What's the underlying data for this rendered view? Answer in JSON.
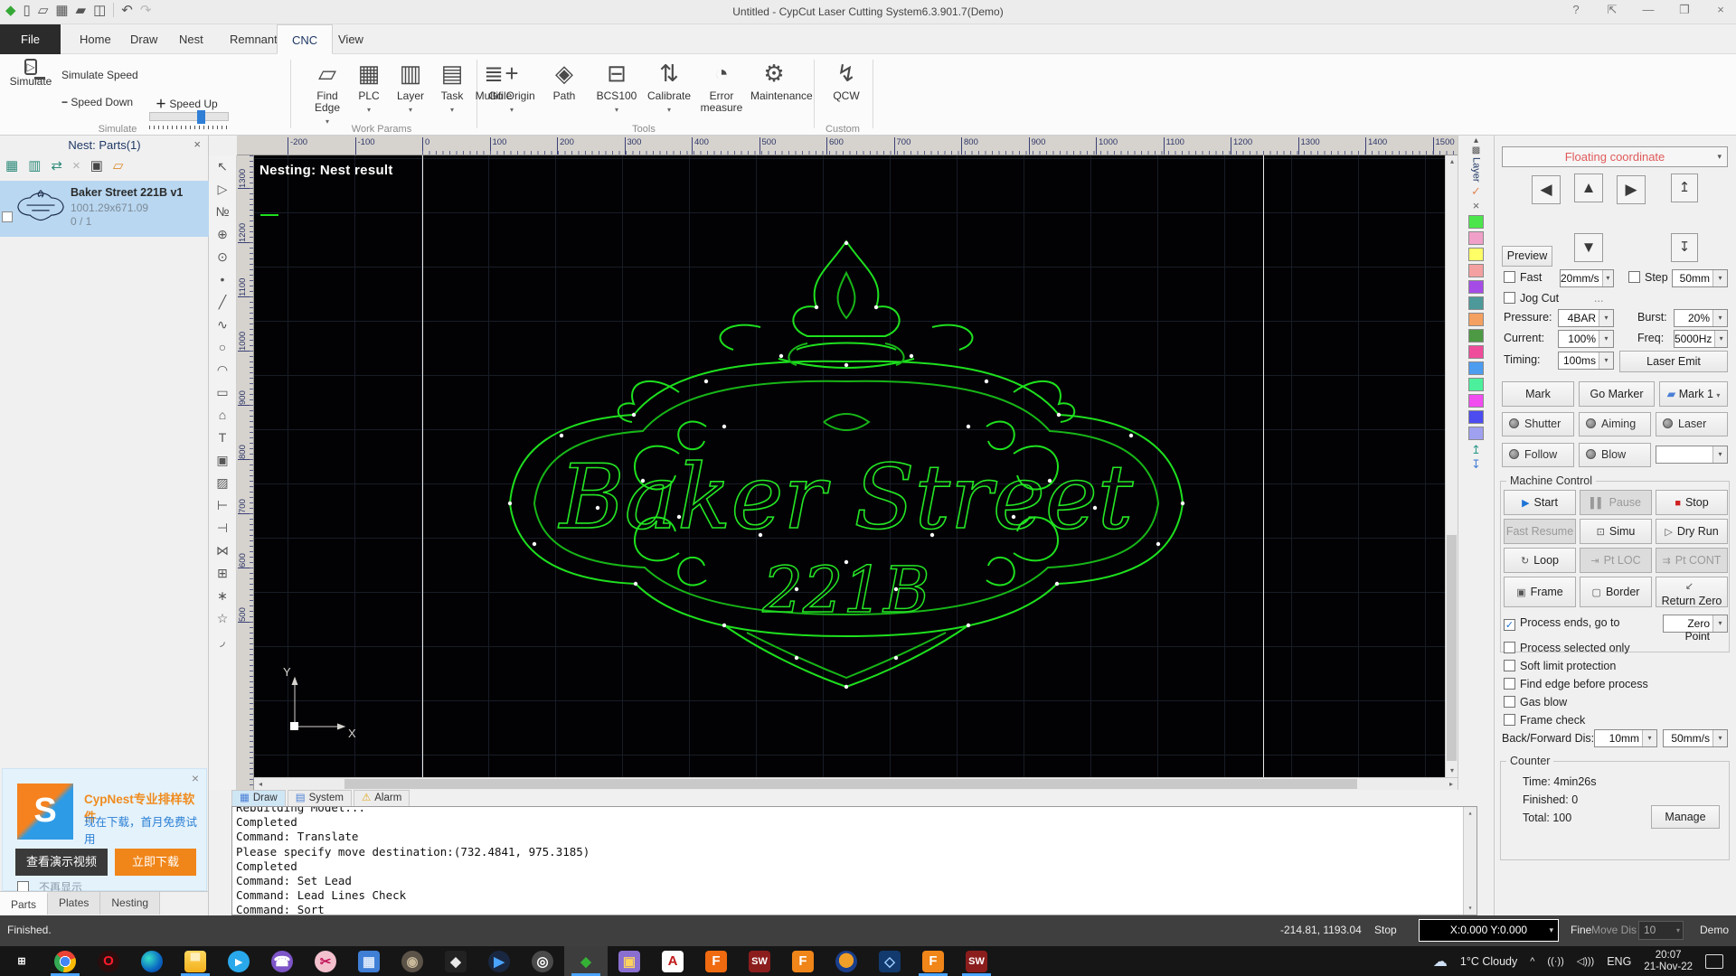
{
  "icons": {
    "start": "▶",
    "pause": "▌▌",
    "stop": "■",
    "simu": "⊡",
    "dry_run": "▷",
    "loop": "↻",
    "pt_loc": "⇥",
    "pt_cont": "⇉",
    "frame": "▣",
    "border": "▢",
    "return_zero": "↙",
    "up": "▲",
    "down": "▼",
    "left": "◀",
    "right": "▶",
    "z_up": "↥",
    "z_down": "↧",
    "mark1": "▰",
    "help": "?",
    "collapse": "⇱",
    "minimize": "—",
    "restore": "❐",
    "close": "×",
    "undo": "↶",
    "redo": "↷",
    "minus": "−",
    "plus": "＋",
    "warning": "⚠",
    "caret": "▾"
  },
  "title_bar": {
    "title": "Untitled - CypCut Laser Cutting System6.3.901.7(Demo)",
    "quick_icons": [
      {
        "name": "cypcut-logo-icon",
        "glyph": "◆",
        "color": "#35a835"
      },
      {
        "name": "new-file-icon",
        "glyph": "▯",
        "color": "#555"
      },
      {
        "name": "open-file-icon",
        "glyph": "▱",
        "color": "#555"
      },
      {
        "name": "nc-grid-icon",
        "glyph": "▦",
        "color": "#555"
      },
      {
        "name": "import-icon",
        "glyph": "▰",
        "color": "#555"
      },
      {
        "name": "save-icon",
        "glyph": "◫",
        "color": "#555"
      }
    ]
  },
  "tabs": {
    "items": [
      "File",
      "Home",
      "Draw",
      "Nest",
      "Remnant",
      "CNC",
      "View"
    ],
    "active": "CNC"
  },
  "ribbon": {
    "group_labels": [
      "Simulate",
      "Work Params",
      "Tools",
      "Custom"
    ],
    "simulate": {
      "button": "Simulate",
      "speed_label": "Simulate Speed",
      "down": "Speed Down",
      "up": "Speed Up"
    },
    "work_params": [
      {
        "name": "find-edge",
        "label": "Find Edge",
        "glyph": "▱",
        "caret": true
      },
      {
        "name": "plc",
        "label": "PLC",
        "glyph": "▦",
        "caret": true
      },
      {
        "name": "layer",
        "label": "Layer",
        "glyph": "▥",
        "caret": true
      },
      {
        "name": "task",
        "label": "Task",
        "glyph": "▤",
        "caret": true
      },
      {
        "name": "multifile",
        "label": "Multifile",
        "glyph": "≣",
        "caret": false
      }
    ],
    "tools": [
      {
        "name": "go-origin",
        "label": "Go Origin",
        "glyph": "+",
        "caret": true
      },
      {
        "name": "path",
        "label": "Path",
        "glyph": "◈",
        "caret": false
      },
      {
        "name": "bcs100",
        "label": "BCS100",
        "glyph": "⊟",
        "caret": true
      },
      {
        "name": "calibrate",
        "label": "Calibrate",
        "glyph": "⇅",
        "caret": true
      },
      {
        "name": "error-measure",
        "label": "Error measure",
        "glyph": "◔",
        "caret": false
      },
      {
        "name": "maintenance",
        "label": "Maintenance",
        "glyph": "⚙",
        "caret": false
      }
    ],
    "custom": [
      {
        "name": "qcw",
        "label": "QCW",
        "glyph": "↯",
        "caret": false
      }
    ]
  },
  "left_panel": {
    "header": "Nest: Parts(1)",
    "close": "×",
    "toolbar_icons": [
      {
        "name": "part-list-icon",
        "glyph": "▦",
        "color": "#2e8b7a"
      },
      {
        "name": "part-detail-icon",
        "glyph": "▥",
        "color": "#2e8b7a"
      },
      {
        "name": "part-swap-icon",
        "glyph": "⇄",
        "color": "#2e8b7a"
      },
      {
        "name": "part-delete-icon",
        "glyph": "×",
        "color": "#b0b0b0"
      },
      {
        "name": "nest-icon",
        "glyph": "▣",
        "color": "#444"
      },
      {
        "name": "export-icon",
        "glyph": "▱",
        "color": "#d98a2b"
      }
    ],
    "part": {
      "name": "Baker Street 221B v1",
      "size": "1001.29x671.09",
      "count": "0 / 1"
    },
    "ad": {
      "title": "CypNest专业排样软件",
      "subtitle": "现在下载，首月免费试用",
      "logo_letter": "S",
      "btn_video": "查看演示视频",
      "btn_download": "立即下载",
      "dismiss": "不再显示",
      "close": "×"
    },
    "tabs": [
      "Parts",
      "Plates",
      "Nesting"
    ]
  },
  "canvas": {
    "overlay_text": "Nesting: Nest result",
    "h_ruler": [
      -200,
      -100,
      0,
      100,
      200,
      300,
      400,
      500,
      600,
      700,
      800,
      900,
      1000,
      1100,
      1200,
      1300,
      1400,
      1500
    ],
    "v_ruler": [
      1300,
      1200,
      1100,
      1000,
      900,
      800,
      700,
      600,
      500
    ],
    "design": {
      "line1": "Baker Street",
      "line2": "221B",
      "stroke": "#1ee01e"
    },
    "axis": {
      "x": "X",
      "y": "Y"
    },
    "tools": [
      {
        "name": "select",
        "glyph": "↖"
      },
      {
        "name": "node-select",
        "glyph": "▷"
      },
      {
        "name": "number-select",
        "glyph": "№"
      },
      {
        "name": "pan",
        "glyph": "⊕"
      },
      {
        "name": "zoom",
        "glyph": "⊙"
      },
      {
        "name": "point",
        "glyph": "•"
      },
      {
        "name": "line",
        "glyph": "╱"
      },
      {
        "name": "polyline",
        "glyph": "∿"
      },
      {
        "name": "circle",
        "glyph": "○"
      },
      {
        "name": "arc",
        "glyph": "◠"
      },
      {
        "name": "rectangle",
        "glyph": "▭"
      },
      {
        "name": "polygon",
        "glyph": "⌂"
      },
      {
        "name": "text",
        "glyph": "T"
      },
      {
        "name": "puzzle",
        "glyph": "▣"
      },
      {
        "name": "image",
        "glyph": "▨"
      },
      {
        "name": "lead-in",
        "glyph": "⊢"
      },
      {
        "name": "lead-out",
        "glyph": "⊣"
      },
      {
        "name": "mirror",
        "glyph": "⋈"
      },
      {
        "name": "array",
        "glyph": "⊞"
      },
      {
        "name": "optimize",
        "glyph": "∗"
      },
      {
        "name": "wand",
        "glyph": "☆"
      },
      {
        "name": "fillet",
        "glyph": "◞"
      }
    ]
  },
  "layer_strip": {
    "label": "Layer",
    "check": "✓",
    "close": "×",
    "chevron": "▴",
    "layers_glyph": "▩",
    "lead_up": "↥",
    "lead_down": "↧",
    "colors": [
      "#4ce64c",
      "#f0a0c8",
      "#ffff66",
      "#f4a0a0",
      "#a64ce6",
      "#4d9999",
      "#f4a060",
      "#4d9944",
      "#f04c9c",
      "#4c9cf0",
      "#4cf09c",
      "#f04cf0",
      "#4c4cf0",
      "#a0a0f0"
    ]
  },
  "console": {
    "tabs": [
      {
        "name": "draw",
        "label": "Draw",
        "glyph": "▦"
      },
      {
        "name": "system",
        "label": "System",
        "glyph": "▤"
      },
      {
        "name": "alarm",
        "label": "Alarm",
        "glyph": "⚠"
      }
    ],
    "lines": [
      "Rebuilding Model...",
      "Completed",
      "Command: Translate",
      "Please specify move destination:(732.4841, 975.3185)",
      "Completed",
      "Command: Set Lead",
      "Command: Lead Lines Check",
      "Command: Sort"
    ]
  },
  "right_panel": {
    "coordinate": "Floating coordinate",
    "preview": "Preview",
    "fast": {
      "label": "Fast",
      "value": "20mm/s"
    },
    "step": {
      "label": "Step",
      "value": "50mm"
    },
    "jog_cut": "Jog Cut",
    "jog_dots": "...",
    "pressure": {
      "label": "Pressure:",
      "value": "4BAR"
    },
    "burst": {
      "label": "Burst:",
      "value": "20%"
    },
    "current": {
      "label": "Current:",
      "value": "100%"
    },
    "freq": {
      "label": "Freq:",
      "value": "5000Hz"
    },
    "timing": {
      "label": "Timing:",
      "value": "100ms"
    },
    "laser_emit": "Laser Emit",
    "mark": "Mark",
    "go_marker": "Go Marker",
    "mark1": "Mark 1",
    "leds": [
      "Shutter",
      "Aiming",
      "Laser",
      "Follow",
      "Blow"
    ],
    "machine": {
      "title": "Machine Control",
      "start": "Start",
      "pause": "Pause",
      "stop": "Stop",
      "fast_resume": "Fast Resume",
      "simu": "Simu",
      "dry_run": "Dry Run",
      "loop": "Loop",
      "pt_loc": "Pt LOC",
      "pt_cont": "Pt CONT",
      "frame": "Frame",
      "border": "Border",
      "return_zero": "Return Zero"
    },
    "process_ends": {
      "label": "Process ends, go to",
      "value": "Zero Point"
    },
    "options": [
      "Process selected only",
      "Soft limit protection",
      "Find edge before process",
      "Gas blow",
      "Frame check"
    ],
    "back_dis": {
      "label": "Back/Forward Dis:",
      "v1": "10mm",
      "v2": "50mm/s"
    },
    "counter": {
      "title": "Counter",
      "lines": [
        "Time: 4min26s",
        "Finished: 0",
        "Total: 100"
      ],
      "manage": "Manage"
    }
  },
  "status_bar": {
    "left": "Finished.",
    "coords": "-214.81, 1193.04",
    "state": "Stop",
    "xy": "X:0.000 Y:0.000",
    "fine": "Fine",
    "move_label": "Move Dis",
    "move_value": "10",
    "demo": "Demo"
  },
  "taskbar": {
    "apps": [
      {
        "name": "start",
        "glyph": "⊞",
        "bg": "transparent",
        "fg": "#ffffff"
      },
      {
        "name": "chrome",
        "glyph": "",
        "bg": "radial-gradient(circle at 50% 50%, #4285f4 0 30%, #ffffff 30% 36%, transparent 36%), conic-gradient(from -50deg, #ea4335 0 120deg, #fbbc05 120deg 240deg, #34a853 240deg 360deg)",
        "fg": "#fff",
        "round": true,
        "running": true
      },
      {
        "name": "opera",
        "glyph": "O",
        "bg": "#2b0d0d",
        "fg": "#ff1b2d",
        "round": true
      },
      {
        "name": "edge",
        "glyph": "",
        "bg": "radial-gradient(circle at 35% 35%, #35e0c8, #0a67c2 60%, #0b3a8c)",
        "fg": "#fff",
        "round": true
      },
      {
        "name": "file-explorer",
        "glyph": "▀",
        "bg": "linear-gradient(180deg,#ffd75e,#f3b01c)",
        "fg": "#fdeebc",
        "running": true
      },
      {
        "name": "telegram",
        "glyph": "▸",
        "bg": "#29a9eb",
        "fg": "#ffffff",
        "round": true
      },
      {
        "name": "viber",
        "glyph": "☎",
        "bg": "#7d55c7",
        "fg": "#ffffff",
        "round": true
      },
      {
        "name": "snip-tool",
        "glyph": "✂",
        "bg": "#f3c0ce",
        "fg": "#c2185b",
        "round": true
      },
      {
        "name": "calculator",
        "glyph": "▦",
        "bg": "#3f7fd6",
        "fg": "#dce9fb"
      },
      {
        "name": "gimp",
        "glyph": "◉",
        "bg": "#5b5248",
        "fg": "#c8b89a",
        "round": true
      },
      {
        "name": "inkscape",
        "glyph": "◆",
        "bg": "#222222",
        "fg": "#e8e8e8"
      },
      {
        "name": "media-app",
        "glyph": "▶",
        "bg": "#1a2740",
        "fg": "#4aa3ff",
        "round": true
      },
      {
        "name": "obs",
        "glyph": "◎",
        "bg": "#4a4a4a",
        "fg": "#ffffff",
        "round": true
      },
      {
        "name": "cypcut",
        "glyph": "◆",
        "bg": "transparent",
        "fg": "#35b235",
        "running": true,
        "active": true
      },
      {
        "name": "box-app",
        "glyph": "▣",
        "bg": "#8a6fd0",
        "fg": "#ffd35e"
      },
      {
        "name": "autocad",
        "glyph": "A",
        "bg": "#ffffff",
        "fg": "#c01919"
      },
      {
        "name": "freecad",
        "glyph": "F",
        "bg": "#f06a10",
        "fg": "#ffffff"
      },
      {
        "name": "solidworks",
        "glyph": "SW",
        "bg": "#8c1d1d",
        "fg": "#ffffff"
      },
      {
        "name": "fusion360",
        "glyph": "F",
        "bg": "#f08519",
        "fg": "#ffffff"
      },
      {
        "name": "orange-ball-app",
        "glyph": "",
        "bg": "radial-gradient(circle at 50% 45%, #f0a028 0 45%, #1a3f8c 46%)",
        "fg": "#fff",
        "round": true
      },
      {
        "name": "3d-viewer",
        "glyph": "◇",
        "bg": "#123a6e",
        "fg": "#9fd0ff"
      },
      {
        "name": "fusion360-2",
        "glyph": "F",
        "bg": "#f08519",
        "fg": "#ffffff",
        "running": true
      },
      {
        "name": "solidworks-2",
        "glyph": "SW",
        "bg": "#8c1d1d",
        "fg": "#ffffff",
        "running": true
      }
    ],
    "tray": {
      "weather": "1°C Cloudy",
      "chevron": "^",
      "lang": "ENG",
      "time": "20:07",
      "date": "21-Nov-22"
    }
  }
}
